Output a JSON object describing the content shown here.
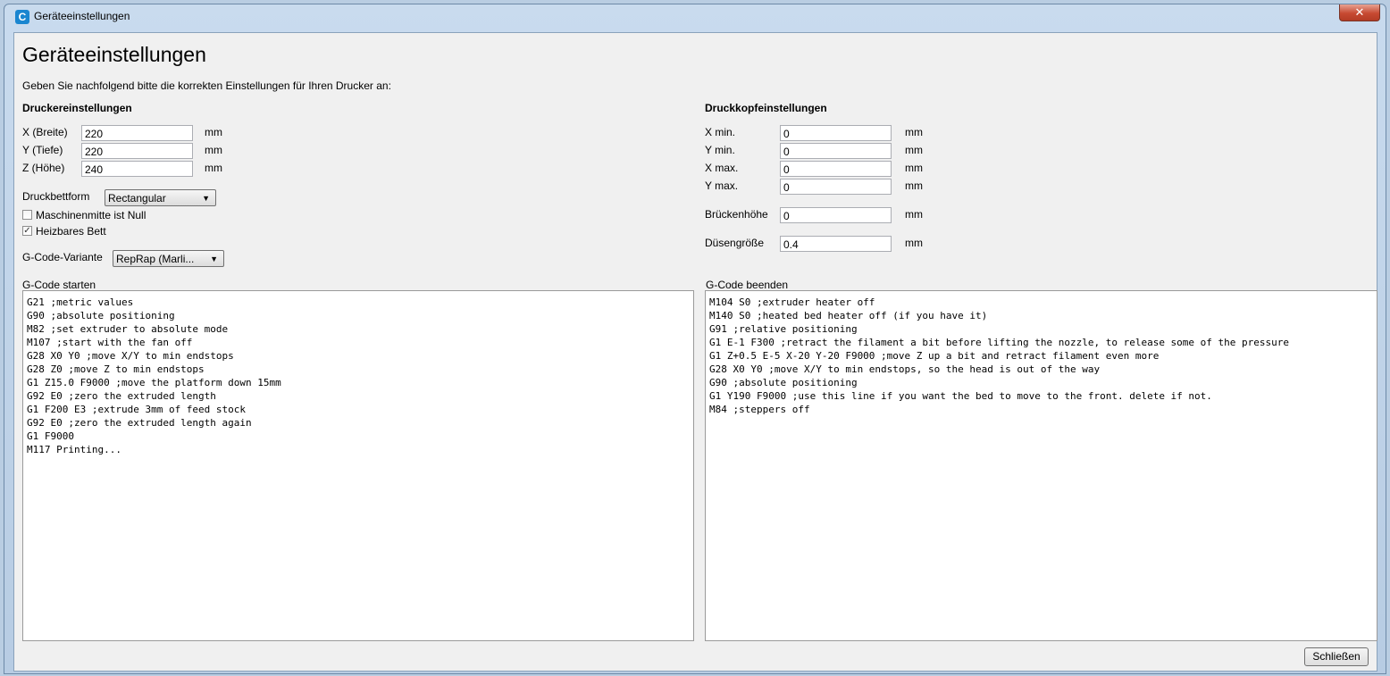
{
  "window": {
    "title": "Geräteeinstellungen",
    "close_glyph": "✕"
  },
  "heading": "Geräteeinstellungen",
  "intro": "Geben Sie nachfolgend bitte die korrekten Einstellungen für Ihren Drucker an:",
  "printer": {
    "title": "Druckereinstellungen",
    "x_label": "X (Breite)",
    "x_value": "220",
    "x_unit": "mm",
    "y_label": "Y (Tiefe)",
    "y_value": "220",
    "y_unit": "mm",
    "z_label": "Z (Höhe)",
    "z_value": "240",
    "z_unit": "mm",
    "bed_shape_label": "Druckbettform",
    "bed_shape_value": "Rectangular",
    "center_zero_label": "Maschinenmitte ist Null",
    "center_zero_checked": false,
    "heated_bed_label": "Heizbares Bett",
    "heated_bed_checked": true,
    "gcode_flavor_label": "G-Code-Variante",
    "gcode_flavor_value": "RepRap (Marli..."
  },
  "printhead": {
    "title": "Druckkopfeinstellungen",
    "xmin_label": "X min.",
    "xmin_value": "0",
    "xmin_unit": "mm",
    "ymin_label": "Y min.",
    "ymin_value": "0",
    "ymin_unit": "mm",
    "xmax_label": "X max.",
    "xmax_value": "0",
    "xmax_unit": "mm",
    "ymax_label": "Y max.",
    "ymax_value": "0",
    "ymax_unit": "mm",
    "gantry_label": "Brückenhöhe",
    "gantry_value": "0",
    "gantry_unit": "mm",
    "nozzle_label": "Düsengröße",
    "nozzle_value": "0.4",
    "nozzle_unit": "mm"
  },
  "start_gcode": {
    "label": "G-Code starten",
    "lines": [
      "G21 ;metric values",
      "G90 ;absolute positioning",
      "M82 ;set extruder to absolute mode",
      "M107 ;start with the fan off",
      "G28 X0 Y0 ;move X/Y to min endstops",
      "G28 Z0 ;move Z to min endstops",
      "G1 Z15.0 F9000 ;move the platform down 15mm",
      "G92 E0 ;zero the extruded length",
      "G1 F200 E3 ;extrude 3mm of feed stock",
      "G92 E0 ;zero the extruded length again",
      "G1 F9000",
      "M117 Printing..."
    ]
  },
  "end_gcode": {
    "label": "G-Code beenden",
    "lines": [
      "M104 S0 ;extruder heater off",
      "M140 S0 ;heated bed heater off (if you have it)",
      "G91 ;relative positioning",
      "G1 E-1 F300 ;retract the filament a bit before lifting the nozzle, to release some of the pressure",
      "G1 Z+0.5 E-5 X-20 Y-20 F9000 ;move Z up a bit and retract filament even more",
      "G28 X0 Y0 ;move X/Y to min endstops, so the head is out of the way",
      "G90 ;absolute positioning",
      "G1 Y190 F9000 ;use this line if you want the bed to move to the front. delete if not.",
      "M84 ;steppers off"
    ]
  },
  "footer": {
    "close_label": "Schließen"
  }
}
